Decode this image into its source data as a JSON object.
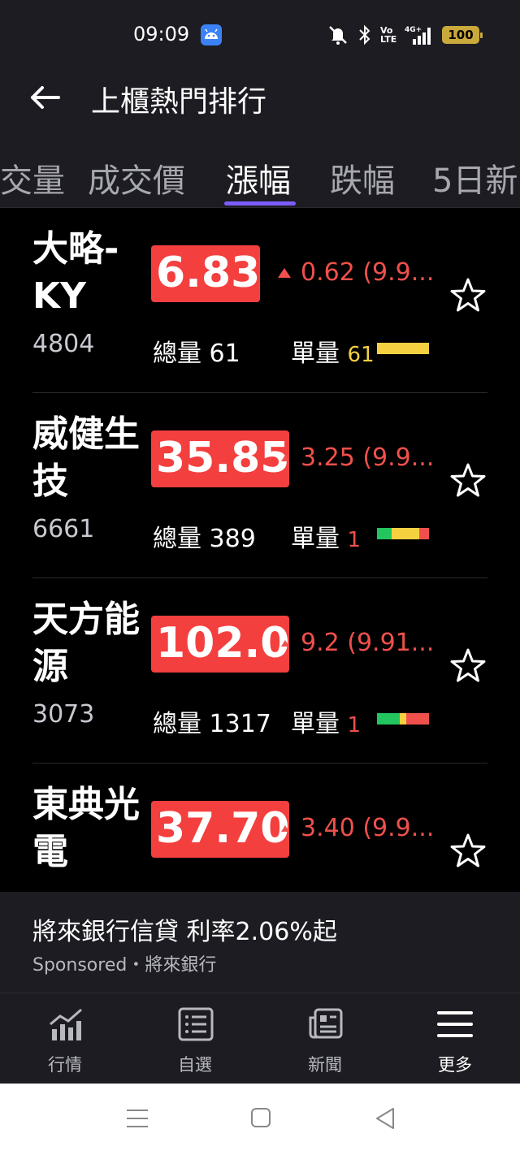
{
  "status_bar": {
    "time": "09:09",
    "battery": "100",
    "icons": [
      "android-icon",
      "mute-icon",
      "bluetooth-icon",
      "volte-icon",
      "4g-signal-icon"
    ],
    "volte_label": "Vo\nLTE",
    "network_label": "4G+"
  },
  "header": {
    "title": "上櫃熱門排行",
    "back_icon": "back-arrow-icon"
  },
  "tabs": [
    {
      "label": "成交量"
    },
    {
      "label": "成交價"
    },
    {
      "label": "漲幅",
      "active": true
    },
    {
      "label": "跌幅"
    },
    {
      "label": "5日新"
    }
  ],
  "stocks": [
    {
      "name": "大略-KY",
      "code": "4804",
      "price": "6.83",
      "change": "0.62 (9.9...",
      "total_volume_label": "總量",
      "total_volume": "61",
      "unit_volume_label": "單量",
      "unit_volume": "61"
    },
    {
      "name": "威健生技",
      "code": "6661",
      "price": "35.85",
      "change": "3.25 (9.9...",
      "total_volume_label": "總量",
      "total_volume": "389",
      "unit_volume_label": "單量",
      "unit_volume": "1"
    },
    {
      "name": "天方能源",
      "code": "3073",
      "price": "102.0",
      "change": "9.2 (9.91...",
      "total_volume_label": "總量",
      "total_volume": "1317",
      "unit_volume_label": "單量",
      "unit_volume": "1"
    },
    {
      "name": "東典光電",
      "price": "37.70",
      "change": "3.40 (9.9..."
    }
  ],
  "ad": {
    "title": "將來銀行信貸 利率2.06%起",
    "sponsor": "Sponsored・將來銀行"
  },
  "bottom_nav": [
    {
      "label": "行情",
      "icon": "chart-icon"
    },
    {
      "label": "自選",
      "icon": "list-icon"
    },
    {
      "label": "新聞",
      "icon": "news-icon"
    },
    {
      "label": "更多",
      "icon": "menu-icon",
      "active": true
    }
  ],
  "colors": {
    "up_red": "#f43f3f",
    "accent": "#7c5cff",
    "yellow": "#f5d142",
    "green": "#22c55e"
  }
}
